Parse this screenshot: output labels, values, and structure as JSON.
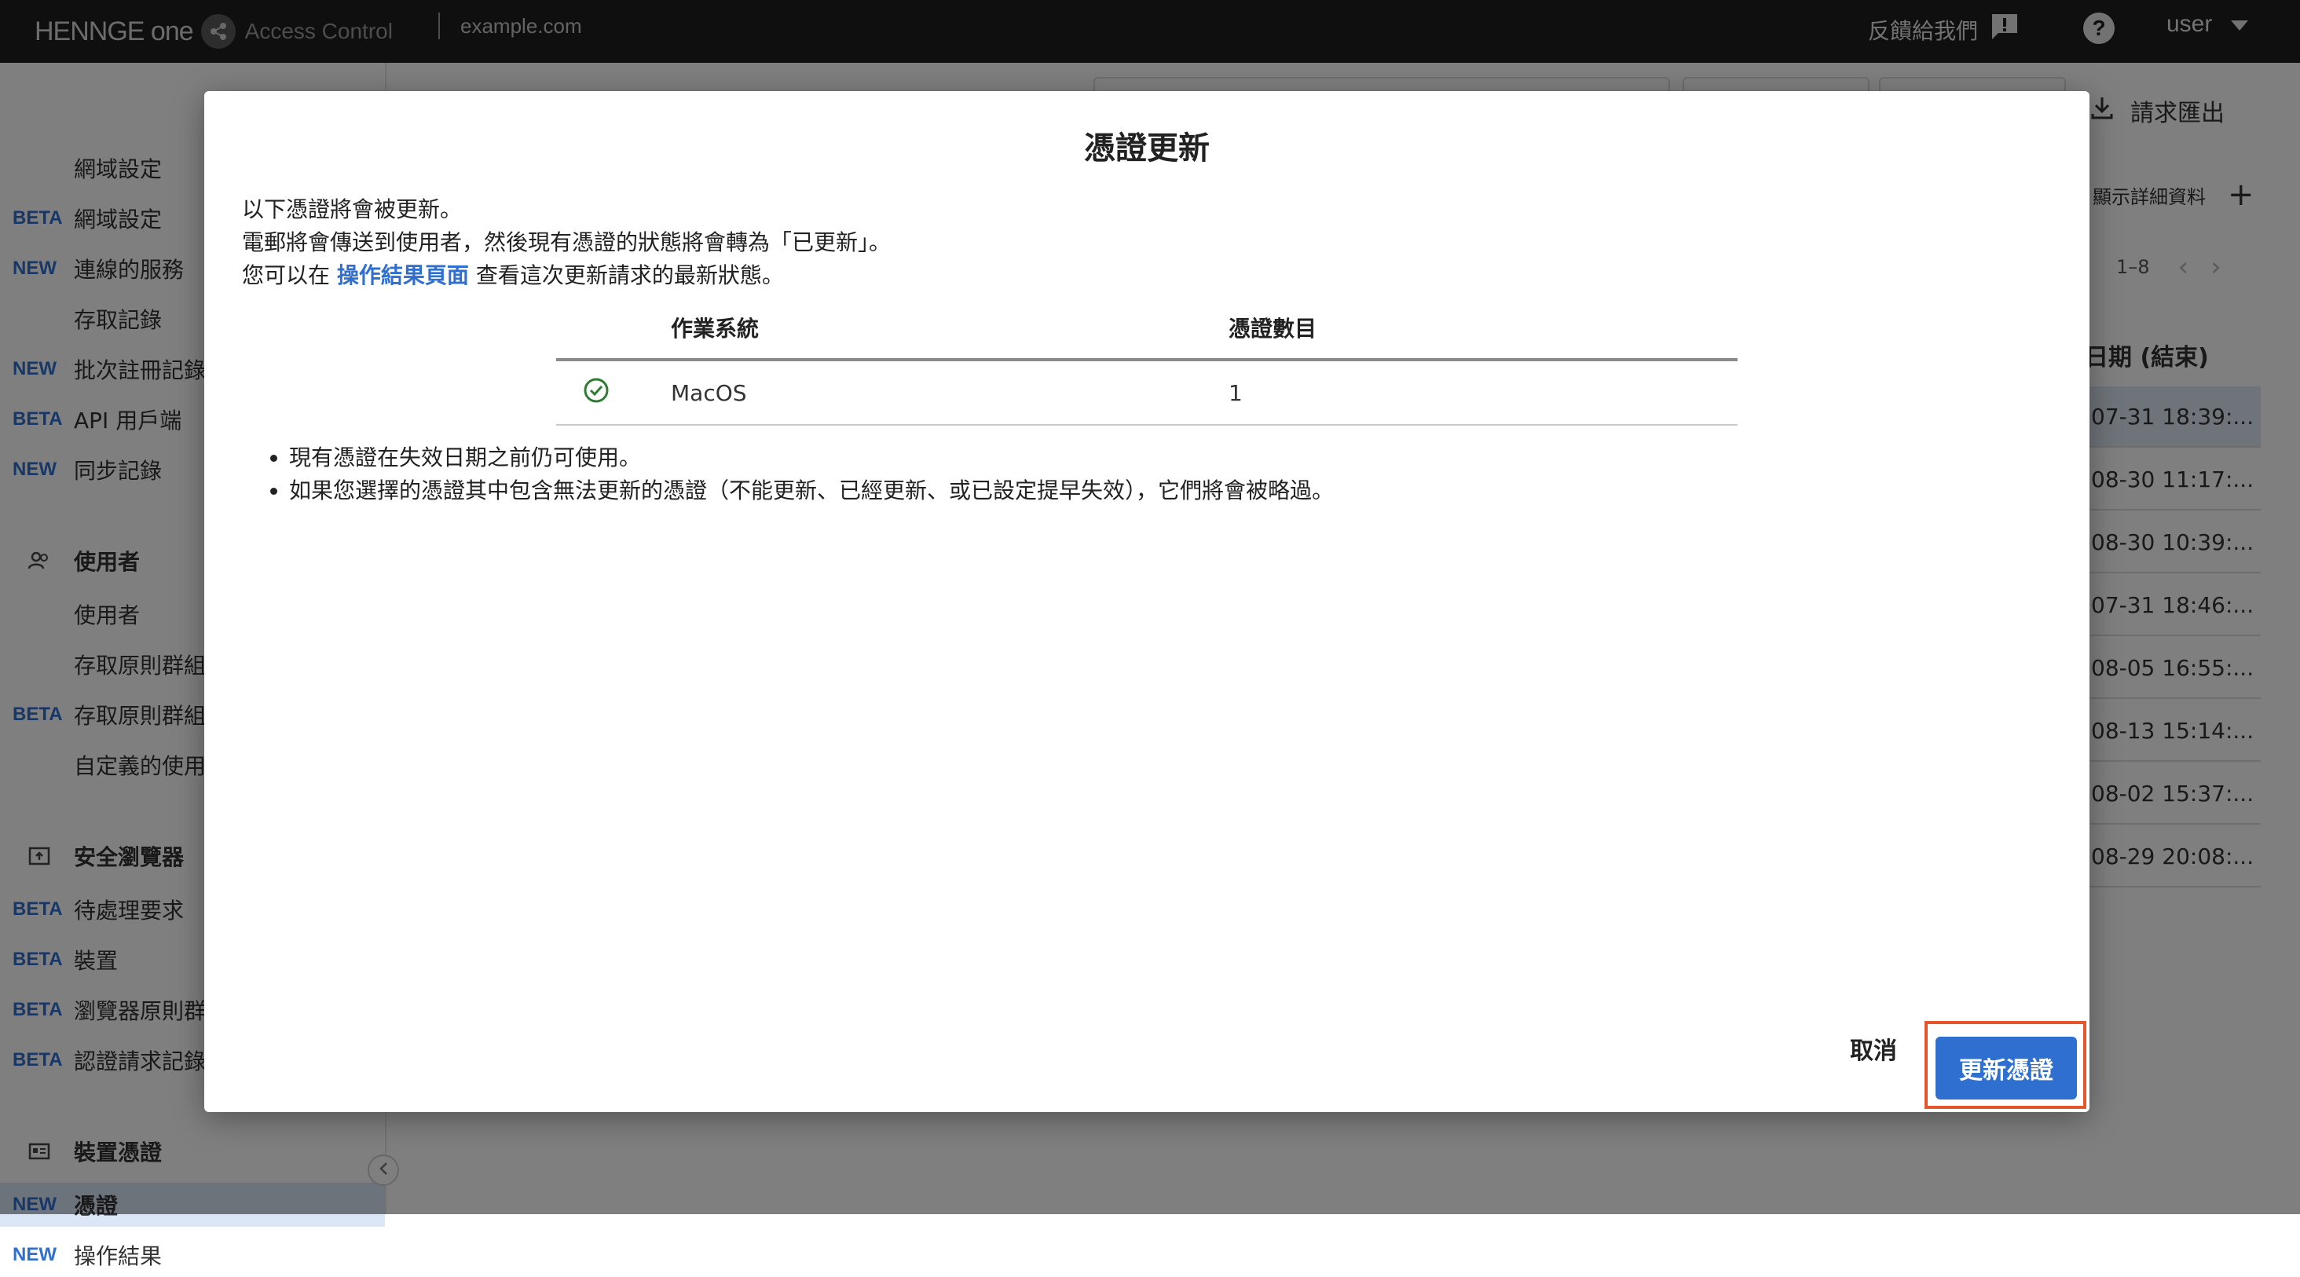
{
  "topbar": {
    "brand_name": "HENNGE one",
    "product": "Access Control",
    "domain": "example.com",
    "feedback_label": "反饋給我們",
    "user_label": "user"
  },
  "sidebar": {
    "items": [
      {
        "badge": "",
        "label": "網域設定"
      },
      {
        "badge": "BETA",
        "label": "網域設定"
      },
      {
        "badge": "NEW",
        "label": "連線的服務"
      },
      {
        "badge": "",
        "label": "存取記錄"
      },
      {
        "badge": "NEW",
        "label": "批次註冊記錄"
      },
      {
        "badge": "BETA",
        "label": "API 用戶端"
      },
      {
        "badge": "NEW",
        "label": "同步記錄"
      },
      {
        "badge": "",
        "label": "使用者",
        "section": true
      },
      {
        "badge": "",
        "label": "使用者"
      },
      {
        "badge": "",
        "label": "存取原則群組"
      },
      {
        "badge": "BETA",
        "label": "存取原則群組"
      },
      {
        "badge": "",
        "label": "自定義的使用"
      },
      {
        "badge": "",
        "label": "安全瀏覽器",
        "section": true
      },
      {
        "badge": "BETA",
        "label": "待處理要求"
      },
      {
        "badge": "BETA",
        "label": "裝置"
      },
      {
        "badge": "BETA",
        "label": "瀏覽器原則群"
      },
      {
        "badge": "BETA",
        "label": "認證請求記錄"
      },
      {
        "badge": "",
        "label": "裝置憑證",
        "section": true
      },
      {
        "badge": "NEW",
        "label": "憑證",
        "active": true
      },
      {
        "badge": "NEW",
        "label": "操作結果"
      }
    ]
  },
  "main": {
    "export_label": "請求匯出",
    "detail_toggle_label": "顯示詳細資料",
    "pager_range": "1–8",
    "column_header": "日期 (結束)",
    "dates": [
      "07-31 18:39:...",
      "08-30 11:17:...",
      "08-30 10:39:...",
      "07-31 18:46:...",
      "08-05 16:55:...",
      "08-13 15:14:...",
      "08-02 15:37:...",
      "08-29 20:08:..."
    ]
  },
  "modal": {
    "title": "憑證更新",
    "intro_line1": "以下憑證將會被更新。",
    "intro_line2": "電郵將會傳送到使用者，然後現有憑證的狀態將會轉為「已更新」。",
    "intro_line3_prefix": "您可以在 ",
    "intro_link": "操作結果頁面",
    "intro_line3_suffix": " 查看這次更新請求的最新狀態。",
    "table": {
      "headers": [
        "作業系統",
        "憑證數目"
      ],
      "rows": [
        {
          "os": "MacOS",
          "count": "1"
        }
      ]
    },
    "notes": [
      "現有憑證在失效日期之前仍可使用。",
      "如果您選擇的憑證其中包含無法更新的憑證（不能更新、已經更新、或已設定提早失效），它們將會被略過。"
    ],
    "cancel_label": "取消",
    "confirm_label": "更新憑證"
  },
  "colors": {
    "accent": "#2f6fcf",
    "highlight": "#e4572e",
    "topbar": "#1f1f1f",
    "success": "#2e7d32"
  }
}
